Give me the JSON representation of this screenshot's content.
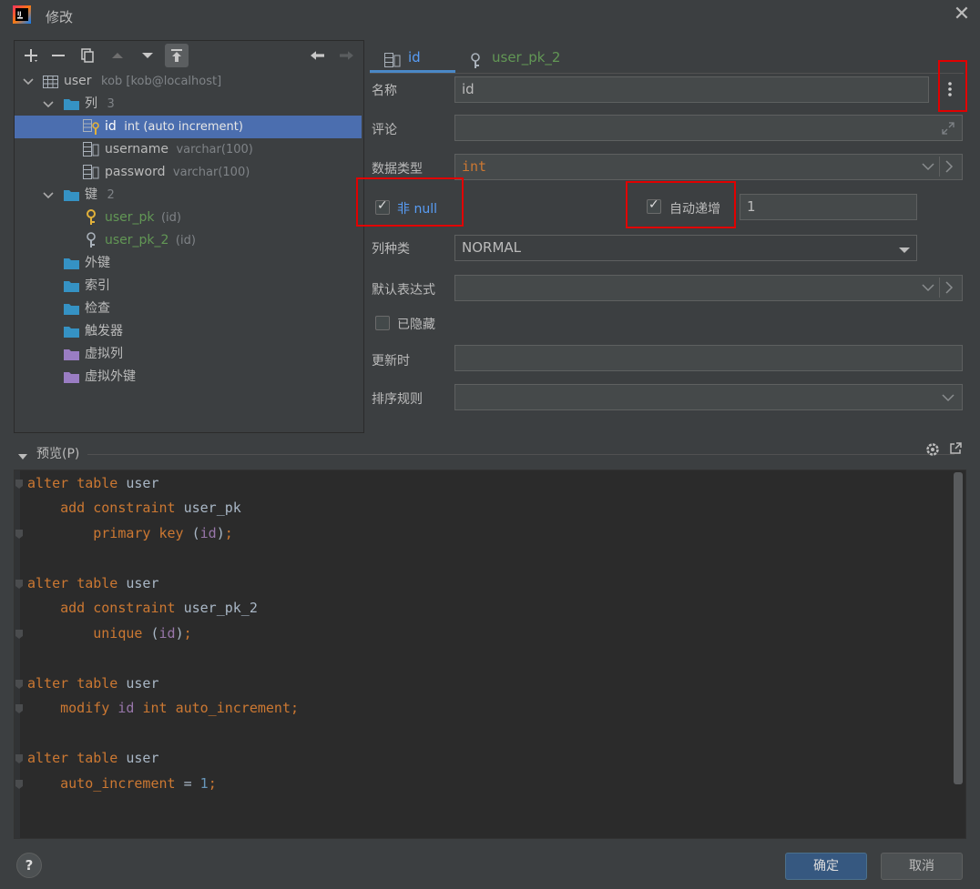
{
  "window": {
    "title": "修改",
    "close_glyph": "✕"
  },
  "tree": {
    "root": {
      "label": "user",
      "hint": "kob [kob@localhost]"
    },
    "columns_group": {
      "label": "列",
      "count": "3"
    },
    "columns": [
      {
        "name": "id",
        "type": "int (auto increment)",
        "selected": true
      },
      {
        "name": "username",
        "type": "varchar(100)"
      },
      {
        "name": "password",
        "type": "varchar(100)"
      }
    ],
    "keys_group": {
      "label": "键",
      "count": "2"
    },
    "keys": [
      {
        "name": "user_pk",
        "target": "(id)"
      },
      {
        "name": "user_pk_2",
        "target": "(id)"
      }
    ],
    "groups": [
      "外键",
      "索引",
      "检查",
      "触发器",
      "虚拟列",
      "虚拟外键"
    ]
  },
  "tabs": [
    {
      "label": "id",
      "icon": "column-icon",
      "active": true
    },
    {
      "label": "user_pk_2",
      "icon": "key-icon",
      "active": false
    }
  ],
  "form": {
    "name_label": "名称",
    "name_value": "id",
    "comment_label": "评论",
    "comment_value": "",
    "datatype_label": "数据类型",
    "datatype_value": "int",
    "notnull_label": "非 null",
    "notnull_checked": true,
    "autoinc_label": "自动递增",
    "autoinc_checked": true,
    "autoinc_value": "1",
    "kind_label": "列种类",
    "kind_value": "NORMAL",
    "default_label": "默认表达式",
    "default_value": "",
    "hidden_label": "已隐藏",
    "hidden_checked": false,
    "onupdate_label": "更新时",
    "onupdate_value": "",
    "collation_label": "排序规则",
    "collation_value": ""
  },
  "preview": {
    "label": "预览(P)",
    "code": [
      [
        "alter table user"
      ],
      [
        "add constraint user_pk"
      ],
      [
        "primary key (id);"
      ],
      [
        "alter table user"
      ],
      [
        "add constraint user_pk_2"
      ],
      [
        "unique (id);"
      ],
      [
        "alter table user"
      ],
      [
        "modify id int auto_increment;"
      ],
      [
        "alter table user"
      ],
      [
        "auto_increment = 1;"
      ]
    ]
  },
  "buttons": {
    "help": "?",
    "ok": "确定",
    "cancel": "取消"
  },
  "colors": {
    "accent": "#4b6eaf",
    "highlight_red": "#e10000",
    "keyword": "#cc7832",
    "green": "#629755"
  }
}
